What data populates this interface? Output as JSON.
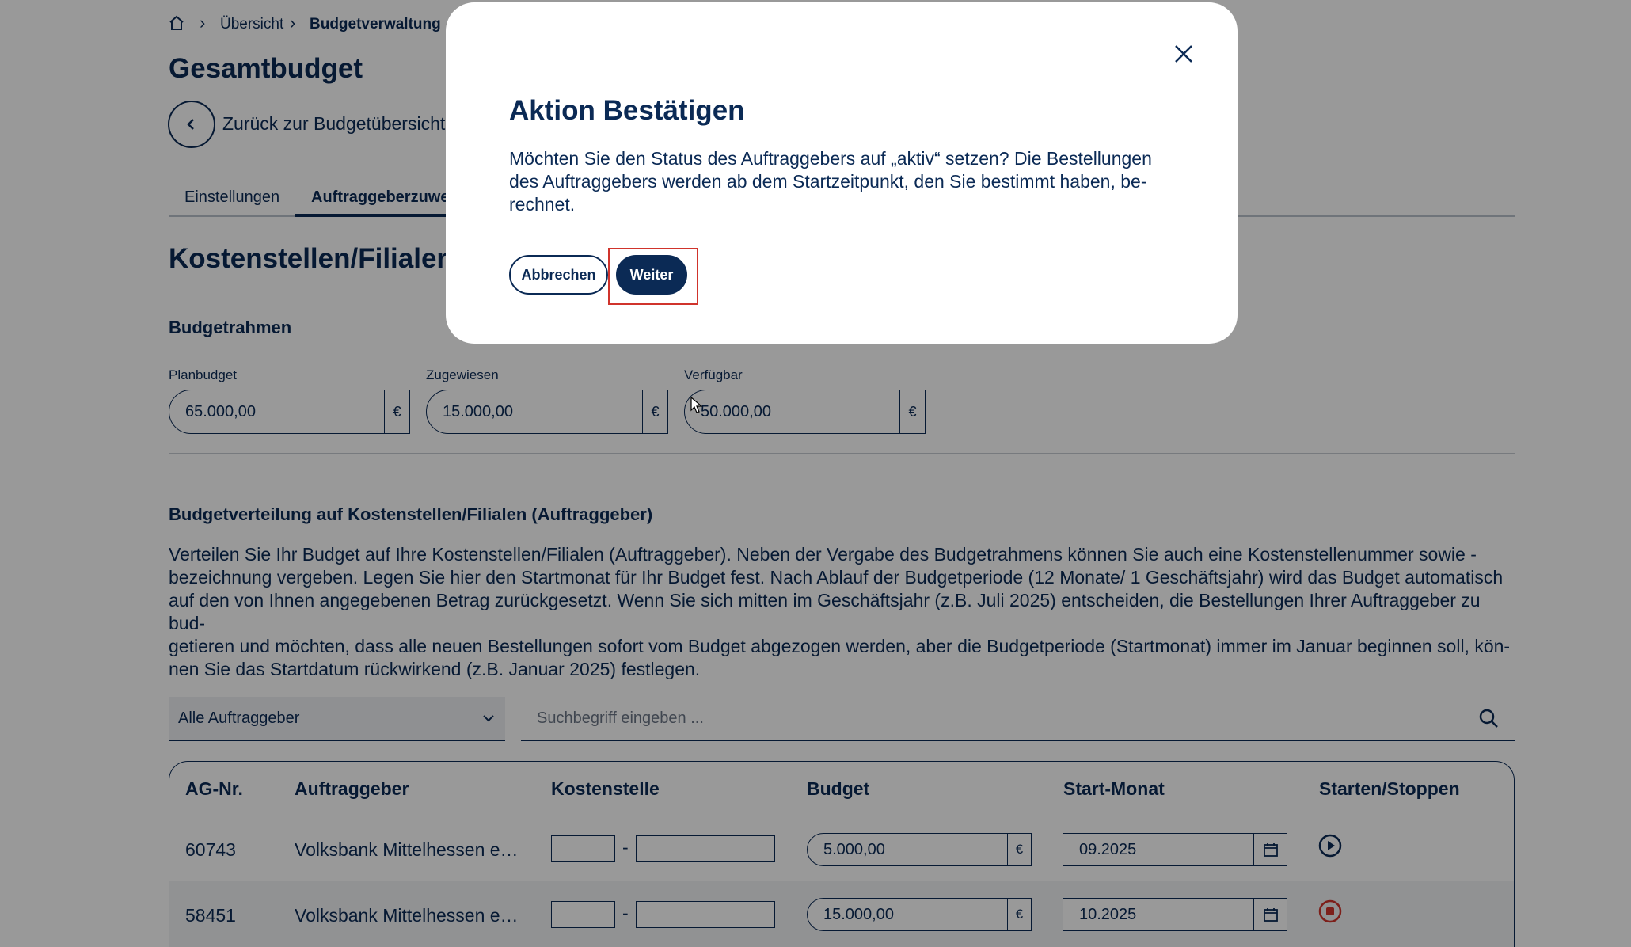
{
  "breadcrumb": {
    "home_icon": "home-icon",
    "item1": "Übersicht",
    "item2": "Budgetverwaltung"
  },
  "page_title": "Gesamtbudget",
  "back_link": "Zurück zur Budgetübersicht",
  "tabs": [
    {
      "label": "Einstellungen"
    },
    {
      "label": "Auftraggeberzuwe"
    }
  ],
  "section_title": "Kostenstellen/Filialen",
  "budgetrahmen": {
    "title": "Budgetrahmen",
    "planbudget": {
      "label": "Planbudget",
      "value": "65.000,00",
      "currency": "€"
    },
    "zugewiesen": {
      "label": "Zugewiesen",
      "value": "15.000,00",
      "currency": "€"
    },
    "verfuegbar": {
      "label": "Verfügbar",
      "value": "50.000,00",
      "currency": "€"
    }
  },
  "distribution": {
    "title": "Budgetverteilung auf Kostenstellen/Filialen (Auftraggeber)",
    "lines": [
      "Verteilen Sie Ihr Budget auf Ihre Kostenstellen/Filialen (Auftraggeber). Neben der Vergabe des Budgetrahmens können Sie auch eine Kostenstellenummer sowie -",
      "bezeichnung vergeben. Legen Sie hier den Startmonat für Ihr Budget fest. Nach Ablauf der Budgetperiode (12 Monate/ 1 Geschäftsjahr) wird das Budget automatisch",
      "auf den von Ihnen angegebenen Betrag zurückgesetzt. Wenn Sie sich mitten im Geschäftsjahr (z.B. Juli 2025) entscheiden, die Bestellungen Ihrer Auftraggeber zu bud-",
      "getieren und möchten, dass alle neuen Bestellungen sofort vom Budget abgezogen werden, aber die Budgetperiode (Startmonat) immer im Januar beginnen soll, kön-",
      "nen Sie das Startdatum rückwirkend (z.B. Januar 2025) festlegen."
    ]
  },
  "filter": {
    "select_value": "Alle Auftraggeber",
    "search_placeholder": "Suchbegriff eingeben ..."
  },
  "table": {
    "headers": [
      "AG-Nr.",
      "Auftraggeber",
      "Kostenstelle",
      "Budget",
      "Start-Monat",
      "Starten/Stoppen"
    ],
    "rows": [
      {
        "ag_nr": "60743",
        "auftraggeber": "Volksbank Mittelhessen e…",
        "budget": "5.000,00",
        "currency": "€",
        "start": "09.2025",
        "action": "play-icon"
      },
      {
        "ag_nr": "58451",
        "auftraggeber": "Volksbank Mittelhessen e…",
        "budget": "15.000,00",
        "currency": "€",
        "start": "10.2025",
        "action": "stop-icon"
      }
    ],
    "separator": "-"
  },
  "modal": {
    "title": "Aktion Bestätigen",
    "lines": [
      "Möchten Sie den Status des Auftraggebers auf „aktiv“ setzen? Die Bestellungen",
      "des Auftraggebers werden ab dem Startzeitpunkt, den Sie bestimmt haben, be-",
      "rechnet."
    ],
    "cancel_label": "Abbrechen",
    "confirm_label": "Weiter"
  },
  "colors": {
    "primary": "#0b2a55",
    "stop": "#d0342c",
    "overlay": "rgba(0,0,0,0.4)"
  }
}
